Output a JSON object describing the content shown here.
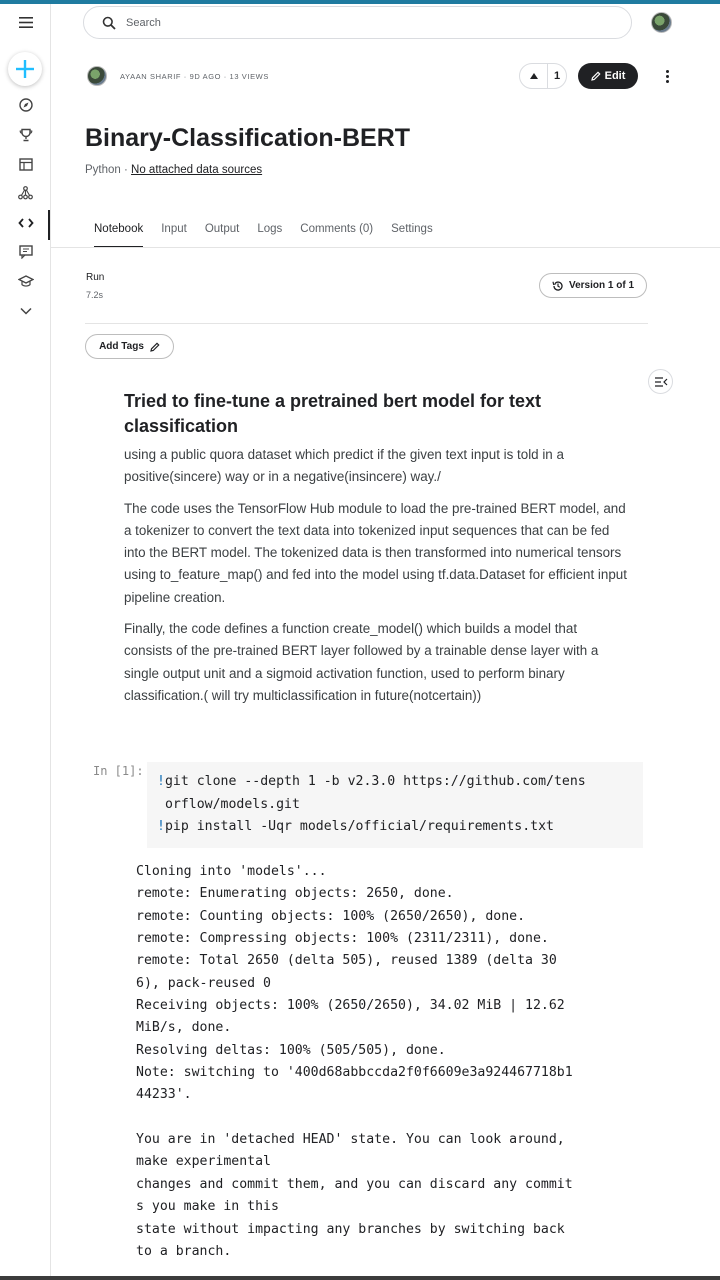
{
  "search": {
    "placeholder": "Search"
  },
  "author": {
    "meta": "AYAAN SHARIF · 9D AGO · 13 VIEWS"
  },
  "votes": {
    "count": "1"
  },
  "actions": {
    "edit_label": "Edit"
  },
  "notebook": {
    "title": "Binary-Classification-BERT",
    "language": "Python · ",
    "data_sources": "No attached data sources"
  },
  "tabs": [
    {
      "label": "Notebook",
      "active": true
    },
    {
      "label": "Input"
    },
    {
      "label": "Output"
    },
    {
      "label": "Logs"
    },
    {
      "label": "Comments (0)"
    },
    {
      "label": "Settings"
    }
  ],
  "run": {
    "label": "Run",
    "time": "7.2s",
    "version": "Version 1 of 1"
  },
  "tags": {
    "label": "Add Tags"
  },
  "markdown": {
    "heading": "Tried to fine-tune a pretrained bert model for text classification",
    "p1": "using a public quora dataset which predict if the given text input is told in a positive(sincere) way or in a negative(insincere) way./",
    "p2": "The code uses the TensorFlow Hub module to load the pre-trained BERT model, and a tokenizer to convert the text data into tokenized input sequences that can be fed into the BERT model. The tokenized data is then transformed into numerical tensors using to_feature_map() and fed into the model using tf.data.Dataset for efficient input pipeline creation.",
    "p3": "Finally, the code defines a function create_model() which builds a model that consists of the pre-trained BERT layer followed by a trainable dense layer with a single output unit and a sigmoid activation function, used to perform binary classification.( will try multiclassification in future(notcertain))"
  },
  "cell": {
    "prompt": "In [1]:",
    "line1_bang": "!",
    "line1_a": "git clone --depth 1 -b v2.3.0 https://github.com/tens",
    "line1_b": "orflow/models.git",
    "line2_bang": "!",
    "line2": "pip install -Uqr models/official/requirements.txt",
    "output": "Cloning into 'models'...\nremote: Enumerating objects: 2650, done.\nremote: Counting objects: 100% (2650/2650), done.\nremote: Compressing objects: 100% (2311/2311), done.\nremote: Total 2650 (delta 505), reused 1389 (delta 30\n6), pack-reused 0\nReceiving objects: 100% (2650/2650), 34.02 MiB | 12.62\nMiB/s, done.\nResolving deltas: 100% (505/505), done.\nNote: switching to '400d68abbccda2f0f6609e3a924467718b1\n44233'.\n\nYou are in 'detached HEAD' state. You can look around,\nmake experimental\nchanges and commit them, and you can discard any commit\ns you make in this\nstate without impacting any branches by switching back\nto a branch."
  },
  "icons": {
    "menu": "hamburger-icon",
    "create": "plus-icon",
    "explore": "compass-icon",
    "competitions": "trophy-icon",
    "datasets": "table-icon",
    "models": "network-icon",
    "code": "code-icon",
    "discussions": "comment-icon",
    "learn": "graduation-cap-icon",
    "more": "chevron-down-icon"
  },
  "colors": {
    "accent": "#20beff",
    "link": "#1a73b8",
    "primary_button": "#202124"
  }
}
